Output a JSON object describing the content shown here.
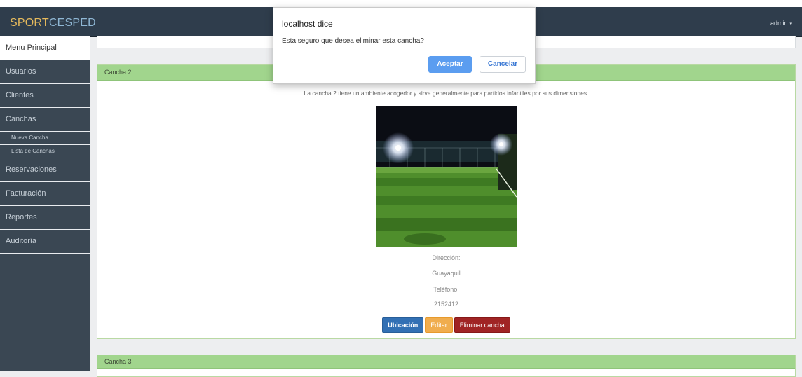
{
  "brand": {
    "part1": "SPORT",
    "part2": "CESPED"
  },
  "user": {
    "name": "admin",
    "caret": "▾"
  },
  "sidebar": {
    "items": [
      {
        "label": "Menu Principal"
      },
      {
        "label": "Usuarios"
      },
      {
        "label": "Clientes"
      },
      {
        "label": "Canchas"
      },
      {
        "label": "Reservaciones"
      },
      {
        "label": "Facturación"
      },
      {
        "label": "Reportes"
      },
      {
        "label": "Auditoría"
      }
    ],
    "subitems": [
      {
        "label": "Nueva Cancha"
      },
      {
        "label": "Lista de Canchas"
      }
    ]
  },
  "panel": {
    "title": "Cancha 2",
    "description": "La cancha 2 tiene un ambiente acogedor y sirve generalmente para partidos infantiles por sus dimensiones.",
    "address_label": "Dirección:",
    "address_value": "Guayaquil",
    "phone_label": "Teléfono:",
    "phone_value": "2152412",
    "buttons": {
      "location": "Ubicación",
      "edit": "Editar",
      "delete": "Eliminar cancha"
    }
  },
  "panel3": {
    "title": "Cancha 3"
  },
  "dialog": {
    "title": "localhost dice",
    "message": "Esta seguro que desea eliminar esta cancha?",
    "ok": "Aceptar",
    "cancel": "Cancelar"
  },
  "colors": {
    "topbar": "#2f3d4c",
    "sidebar": "#3a4753",
    "panel_header": "#a1d58d",
    "btn_location": "#3270b4",
    "btn_edit": "#f0ad4e",
    "btn_delete": "#a02424",
    "dialog_ok": "#5b9df0"
  }
}
